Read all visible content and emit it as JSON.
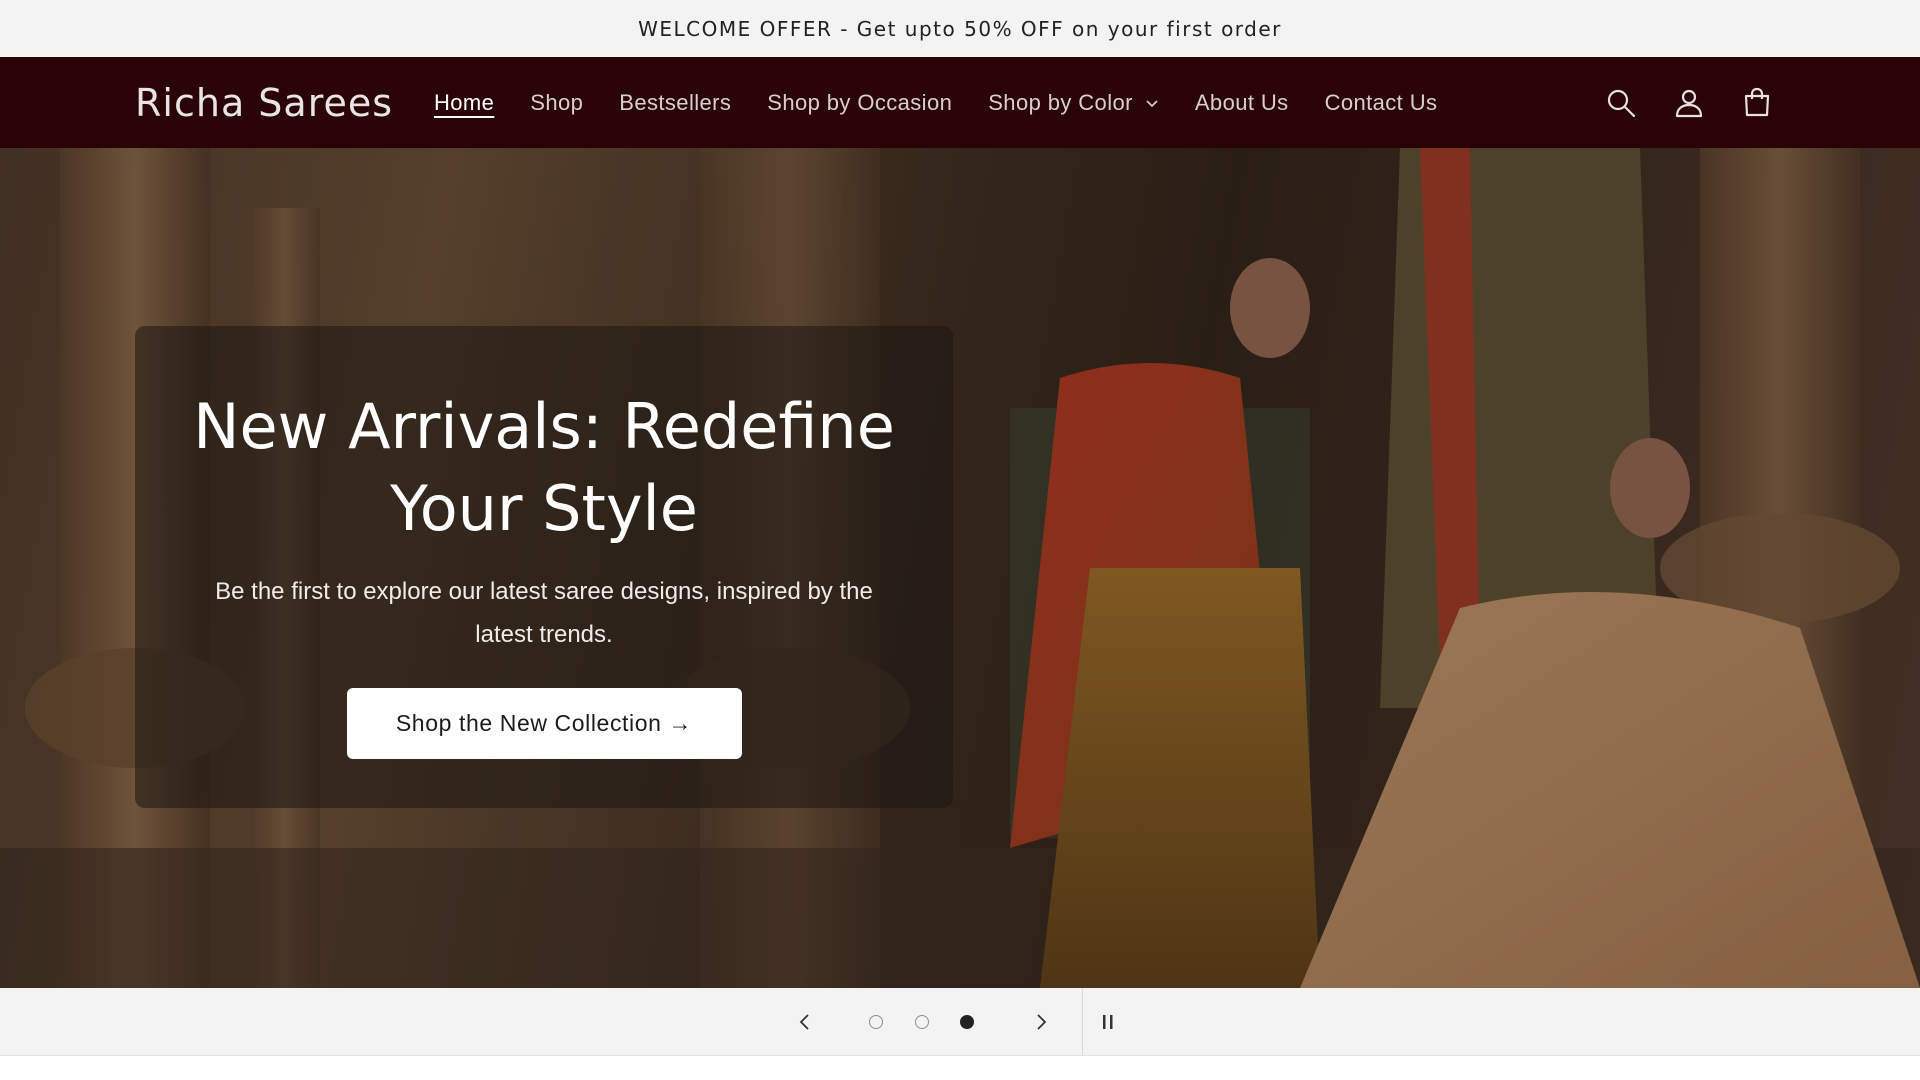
{
  "announcement": {
    "text": "WELCOME OFFER - Get upto 50% OFF on your first order"
  },
  "header": {
    "logo": "Richa Sarees",
    "nav": [
      {
        "label": "Home",
        "active": true
      },
      {
        "label": "Shop"
      },
      {
        "label": "Bestsellers"
      },
      {
        "label": "Shop by Occasion"
      },
      {
        "label": "Shop by Color",
        "has_dropdown": true
      },
      {
        "label": "About Us"
      },
      {
        "label": "Contact Us"
      }
    ],
    "icons": [
      "search-icon",
      "account-icon",
      "cart-icon"
    ]
  },
  "hero": {
    "title": "New Arrivals: Redefine Your Style",
    "subtitle": "Be the first to explore our latest saree designs, inspired by the latest trends.",
    "button_label": "Shop the New Collection →"
  },
  "slider": {
    "slide_count": 3,
    "active_slide": 3,
    "icons": [
      "chevron-left-icon",
      "chevron-right-icon",
      "pause-icon"
    ]
  },
  "colors": {
    "header_bg": "#2a0306",
    "announcement_bg": "#f3f3f3",
    "button_bg": "#ffffff"
  }
}
